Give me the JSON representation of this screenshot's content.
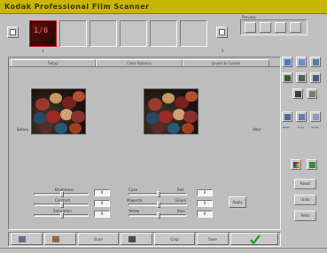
{
  "window": {
    "title": "Kodak Professional Film Scanner"
  },
  "filmstrip": {
    "selected_frame_label": "1/6",
    "frame_number_left": "1",
    "frame_number_right": "2",
    "frames": 6
  },
  "preview_group": {
    "label": "Preview"
  },
  "tabs": [
    {
      "label": "Setup"
    },
    {
      "label": "Color Balance"
    },
    {
      "label": "Levels & Curves"
    }
  ],
  "images": {
    "left_label": "Before",
    "right_label": "After"
  },
  "adjustments": {
    "left": [
      {
        "label": "Brightness",
        "value": "0"
      },
      {
        "label": "Contrast",
        "value": "0"
      },
      {
        "label": "Saturation",
        "value": "0"
      }
    ],
    "right": [
      {
        "label_left": "Cyan",
        "label_right": "Red",
        "value": "0"
      },
      {
        "label_left": "Magenta",
        "label_right": "Green",
        "value": "0"
      },
      {
        "label_left": "Yellow",
        "label_right": "Blue",
        "value": "0"
      }
    ],
    "apply_label": "Apply"
  },
  "right_panel": {
    "eyedropper_labels": [
      "Black",
      "Gray",
      "White"
    ],
    "reset_label": "Reset",
    "undo_label": "Undo",
    "redo_label": "Redo"
  },
  "bottom_bar": {
    "buttons": [
      "Scan",
      "Prescan",
      "Crop",
      "Save",
      "Done"
    ]
  },
  "colors": {
    "titlebar": "#c8b500",
    "selection": "#c02020",
    "check": "#1a9a1a"
  }
}
